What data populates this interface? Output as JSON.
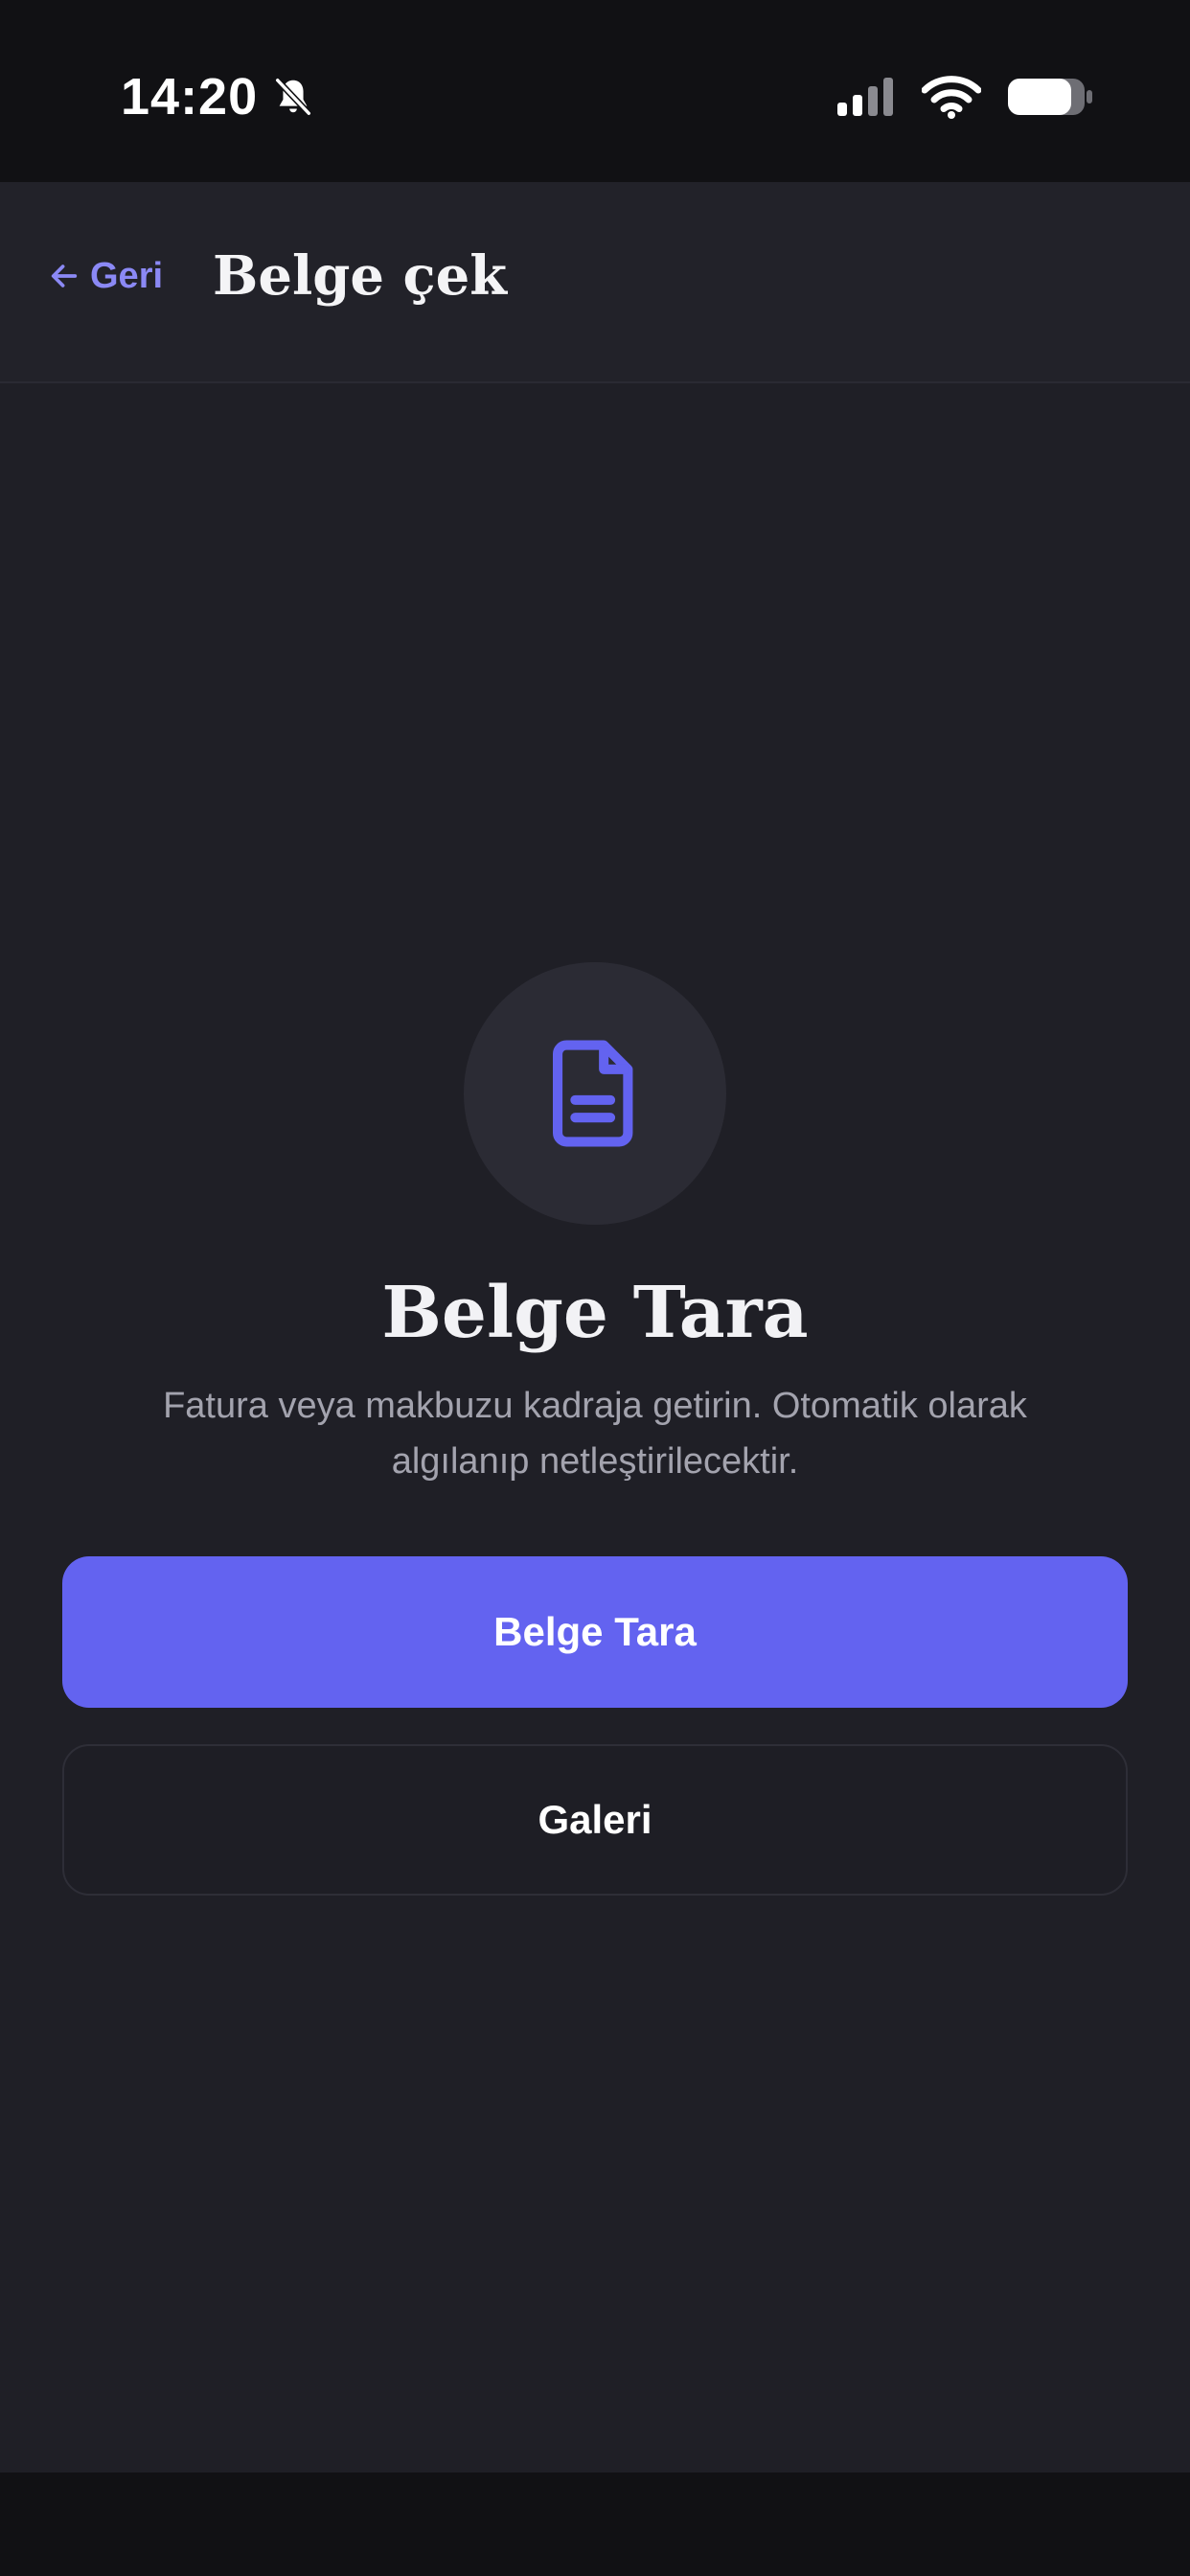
{
  "status_bar": {
    "time": "14:20",
    "icons": [
      "bell-slash-icon",
      "cellular-signal-icon",
      "wifi-icon",
      "battery-icon"
    ]
  },
  "header": {
    "back_label": "Geri",
    "title": "Belge çek"
  },
  "main": {
    "icon": "document-icon",
    "heading": "Belge Tara",
    "description": "Fatura veya makbuzu kadraja getirin. Otomatik olarak algılanıp netleştirilecektir.",
    "primary_button_label": "Belge Tara",
    "secondary_button_label": "Galeri"
  },
  "colors": {
    "accent": "#6363f0",
    "back_link": "#8b89f5",
    "background": "#1f1f26",
    "status_bar": "#111114"
  }
}
